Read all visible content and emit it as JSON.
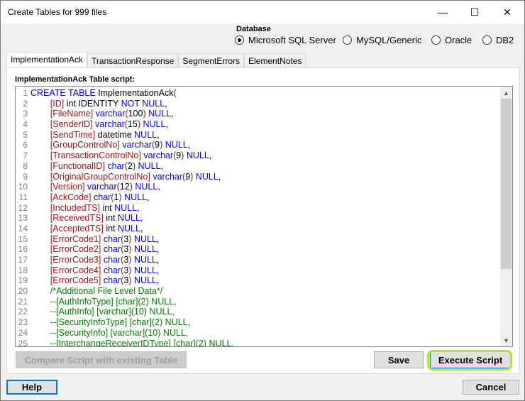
{
  "window": {
    "title": "Create Tables for 999 files",
    "minimize": "—",
    "maximize": "☐",
    "close": "✕"
  },
  "database": {
    "legend": "Database",
    "options": [
      {
        "label": "Microsoft SQL Server",
        "selected": true
      },
      {
        "label": "MySQL/Generic",
        "selected": false
      },
      {
        "label": "Oracle",
        "selected": false
      },
      {
        "label": "DB2",
        "selected": false
      }
    ]
  },
  "tabs": [
    {
      "label": "ImplementationAck",
      "active": true
    },
    {
      "label": "TransactionResponse",
      "active": false
    },
    {
      "label": "SegmentErrors",
      "active": false
    },
    {
      "label": "ElementNotes",
      "active": false
    }
  ],
  "panel": {
    "script_label": "ImplementationAck Table script:"
  },
  "code_lines": [
    {
      "n": "1",
      "parts": [
        [
          "kw",
          "CREATE TABLE"
        ],
        [
          "pl",
          " ImplementationAck"
        ],
        [
          "br",
          "("
        ]
      ]
    },
    {
      "n": "2",
      "parts": [
        [
          "pl",
          "        "
        ],
        [
          "br",
          "[ID]"
        ],
        [
          "pl",
          " int IDENTITY "
        ],
        [
          "kw",
          "NOT NULL"
        ],
        [
          "pl",
          ","
        ]
      ]
    },
    {
      "n": "3",
      "parts": [
        [
          "pl",
          "        "
        ],
        [
          "br",
          "[FileName]"
        ],
        [
          "pl",
          " "
        ],
        [
          "ty",
          "varchar"
        ],
        [
          "br",
          "("
        ],
        [
          "pl",
          "100"
        ],
        [
          "br",
          ")"
        ],
        [
          "pl",
          " "
        ],
        [
          "kw",
          "NULL"
        ],
        [
          "pl",
          ","
        ]
      ]
    },
    {
      "n": "4",
      "parts": [
        [
          "pl",
          "        "
        ],
        [
          "br",
          "[SenderID]"
        ],
        [
          "pl",
          " "
        ],
        [
          "ty",
          "varchar"
        ],
        [
          "br",
          "("
        ],
        [
          "pl",
          "15"
        ],
        [
          "br",
          ")"
        ],
        [
          "pl",
          " "
        ],
        [
          "kw",
          "NULL"
        ],
        [
          "pl",
          ","
        ]
      ]
    },
    {
      "n": "5",
      "parts": [
        [
          "pl",
          "        "
        ],
        [
          "br",
          "[SendTime]"
        ],
        [
          "pl",
          " datetime "
        ],
        [
          "kw",
          "NULL"
        ],
        [
          "pl",
          ","
        ]
      ]
    },
    {
      "n": "6",
      "parts": [
        [
          "pl",
          "        "
        ],
        [
          "br",
          "[GroupControlNo]"
        ],
        [
          "pl",
          " "
        ],
        [
          "ty",
          "varchar"
        ],
        [
          "br",
          "("
        ],
        [
          "pl",
          "9"
        ],
        [
          "br",
          ")"
        ],
        [
          "pl",
          " "
        ],
        [
          "kw",
          "NULL"
        ],
        [
          "pl",
          ","
        ]
      ]
    },
    {
      "n": "7",
      "parts": [
        [
          "pl",
          "        "
        ],
        [
          "br",
          "[TransactionControlNo]"
        ],
        [
          "pl",
          " "
        ],
        [
          "ty",
          "varchar"
        ],
        [
          "br",
          "("
        ],
        [
          "pl",
          "9"
        ],
        [
          "br",
          ")"
        ],
        [
          "pl",
          " "
        ],
        [
          "kw",
          "NULL"
        ],
        [
          "pl",
          ","
        ]
      ]
    },
    {
      "n": "8",
      "parts": [
        [
          "pl",
          "        "
        ],
        [
          "br",
          "[FunctionalID]"
        ],
        [
          "pl",
          " "
        ],
        [
          "ty",
          "char"
        ],
        [
          "br",
          "("
        ],
        [
          "pl",
          "2"
        ],
        [
          "br",
          ")"
        ],
        [
          "pl",
          " "
        ],
        [
          "kw",
          "NULL"
        ],
        [
          "pl",
          ","
        ]
      ]
    },
    {
      "n": "9",
      "parts": [
        [
          "pl",
          "        "
        ],
        [
          "br",
          "[OriginalGroupControlNo]"
        ],
        [
          "pl",
          " "
        ],
        [
          "ty",
          "varchar"
        ],
        [
          "br",
          "("
        ],
        [
          "pl",
          "9"
        ],
        [
          "br",
          ")"
        ],
        [
          "pl",
          " "
        ],
        [
          "kw",
          "NULL"
        ],
        [
          "pl",
          ","
        ]
      ]
    },
    {
      "n": "10",
      "parts": [
        [
          "pl",
          "        "
        ],
        [
          "br",
          "[Version]"
        ],
        [
          "pl",
          " "
        ],
        [
          "ty",
          "varchar"
        ],
        [
          "br",
          "("
        ],
        [
          "pl",
          "12"
        ],
        [
          "br",
          ")"
        ],
        [
          "pl",
          " "
        ],
        [
          "kw",
          "NULL"
        ],
        [
          "pl",
          ","
        ]
      ]
    },
    {
      "n": "11",
      "parts": [
        [
          "pl",
          "        "
        ],
        [
          "br",
          "[AckCode]"
        ],
        [
          "pl",
          " "
        ],
        [
          "ty",
          "char"
        ],
        [
          "br",
          "("
        ],
        [
          "pl",
          "1"
        ],
        [
          "br",
          ")"
        ],
        [
          "pl",
          " "
        ],
        [
          "kw",
          "NULL"
        ],
        [
          "pl",
          ","
        ]
      ]
    },
    {
      "n": "12",
      "parts": [
        [
          "pl",
          "        "
        ],
        [
          "br",
          "[IncludedTS]"
        ],
        [
          "pl",
          " int "
        ],
        [
          "kw",
          "NULL"
        ],
        [
          "pl",
          ","
        ]
      ]
    },
    {
      "n": "13",
      "parts": [
        [
          "pl",
          "        "
        ],
        [
          "br",
          "[ReceivedTS]"
        ],
        [
          "pl",
          " int "
        ],
        [
          "kw",
          "NULL"
        ],
        [
          "pl",
          ","
        ]
      ]
    },
    {
      "n": "14",
      "parts": [
        [
          "pl",
          "        "
        ],
        [
          "br",
          "[AcceptedTS]"
        ],
        [
          "pl",
          " int "
        ],
        [
          "kw",
          "NULL"
        ],
        [
          "pl",
          ","
        ]
      ]
    },
    {
      "n": "15",
      "parts": [
        [
          "pl",
          "        "
        ],
        [
          "br",
          "[ErrorCode1]"
        ],
        [
          "pl",
          " "
        ],
        [
          "ty",
          "char"
        ],
        [
          "br",
          "("
        ],
        [
          "pl",
          "3"
        ],
        [
          "br",
          ")"
        ],
        [
          "pl",
          " "
        ],
        [
          "kw",
          "NULL"
        ],
        [
          "pl",
          ","
        ]
      ]
    },
    {
      "n": "16",
      "parts": [
        [
          "pl",
          "        "
        ],
        [
          "br",
          "[ErrorCode2]"
        ],
        [
          "pl",
          " "
        ],
        [
          "ty",
          "char"
        ],
        [
          "br",
          "("
        ],
        [
          "pl",
          "3"
        ],
        [
          "br",
          ")"
        ],
        [
          "pl",
          " "
        ],
        [
          "kw",
          "NULL"
        ],
        [
          "pl",
          ","
        ]
      ]
    },
    {
      "n": "17",
      "parts": [
        [
          "pl",
          "        "
        ],
        [
          "br",
          "[ErrorCode3]"
        ],
        [
          "pl",
          " "
        ],
        [
          "ty",
          "char"
        ],
        [
          "br",
          "("
        ],
        [
          "pl",
          "3"
        ],
        [
          "br",
          ")"
        ],
        [
          "pl",
          " "
        ],
        [
          "kw",
          "NULL"
        ],
        [
          "pl",
          ","
        ]
      ]
    },
    {
      "n": "18",
      "parts": [
        [
          "pl",
          "        "
        ],
        [
          "br",
          "[ErrorCode4]"
        ],
        [
          "pl",
          " "
        ],
        [
          "ty",
          "char"
        ],
        [
          "br",
          "("
        ],
        [
          "pl",
          "3"
        ],
        [
          "br",
          ")"
        ],
        [
          "pl",
          " "
        ],
        [
          "kw",
          "NULL"
        ],
        [
          "pl",
          ","
        ]
      ]
    },
    {
      "n": "19",
      "parts": [
        [
          "pl",
          "        "
        ],
        [
          "br",
          "[ErrorCode5]"
        ],
        [
          "pl",
          " "
        ],
        [
          "ty",
          "char"
        ],
        [
          "br",
          "("
        ],
        [
          "pl",
          "3"
        ],
        [
          "br",
          ")"
        ],
        [
          "pl",
          " "
        ],
        [
          "kw",
          "NULL"
        ],
        [
          "pl",
          ","
        ]
      ]
    },
    {
      "n": "20",
      "parts": [
        [
          "pl",
          "        "
        ],
        [
          "cm",
          "/*Additional File Level Data*/"
        ]
      ]
    },
    {
      "n": "21",
      "parts": [
        [
          "pl",
          "        "
        ],
        [
          "cm",
          "--[AuthInfoType] [char](2) NULL,"
        ]
      ]
    },
    {
      "n": "22",
      "parts": [
        [
          "pl",
          "        "
        ],
        [
          "cm",
          "--[AuthInfo] [varchar](10) NULL,"
        ]
      ]
    },
    {
      "n": "23",
      "parts": [
        [
          "pl",
          "        "
        ],
        [
          "cm",
          "--[SecurityInfoType] [char](2) NULL,"
        ]
      ]
    },
    {
      "n": "24",
      "parts": [
        [
          "pl",
          "        "
        ],
        [
          "cm",
          "--[SecurityInfo] [varchar](10) NULL,"
        ]
      ]
    },
    {
      "n": "25",
      "parts": [
        [
          "pl",
          "        "
        ],
        [
          "cm",
          "--[InterchangeReceiverIDType] [char](2) NULL,"
        ]
      ]
    }
  ],
  "buttons": {
    "compare": "Compare Script with existing Table",
    "save": "Save",
    "execute": "Execute Script",
    "help": "Help",
    "cancel": "Cancel"
  },
  "scroll": {
    "up": "▲",
    "down": "▼"
  }
}
